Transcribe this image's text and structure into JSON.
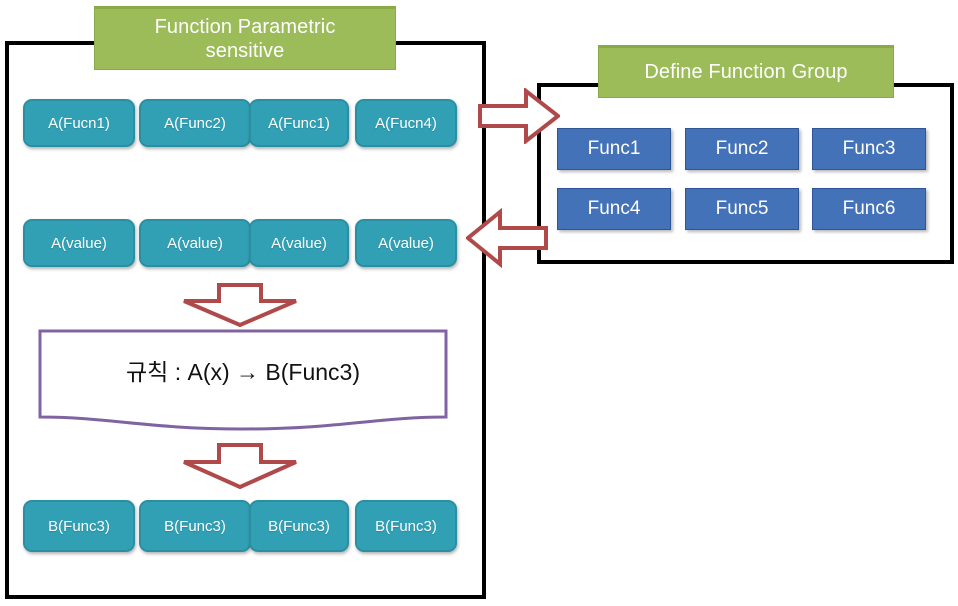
{
  "diagram": {
    "title_left": "Function Parametric\nsensitive",
    "title_right": "Define Function Group"
  },
  "left_panel": {
    "banner_line1": "Function Parametric",
    "banner_line2": "sensitive",
    "func_row": [
      {
        "label": "A(Fucn1)"
      },
      {
        "label": "A(Func2)"
      },
      {
        "label": "A(Func1)"
      },
      {
        "label": "A(Fucn4)"
      }
    ],
    "value_row": [
      {
        "label": "A(value)"
      },
      {
        "label": "A(value)"
      },
      {
        "label": "A(value)"
      },
      {
        "label": "A(value)"
      }
    ],
    "rule": {
      "text": "규칙 : A(x) → B(Func3)"
    },
    "result_row": [
      {
        "label": "B(Func3)"
      },
      {
        "label": "B(Func3)"
      },
      {
        "label": "B(Func3)"
      },
      {
        "label": "B(Func3)"
      }
    ]
  },
  "right_panel": {
    "banner": "Define Function Group",
    "functions": [
      {
        "label": "Func1"
      },
      {
        "label": "Func2"
      },
      {
        "label": "Func3"
      },
      {
        "label": "Func4"
      },
      {
        "label": "Func5"
      },
      {
        "label": "Func6"
      }
    ]
  },
  "arrows": [
    {
      "name": "arrow-right-top",
      "direction": "right"
    },
    {
      "name": "arrow-left-mid",
      "direction": "left"
    },
    {
      "name": "arrow-down-1",
      "direction": "down"
    },
    {
      "name": "arrow-down-2",
      "direction": "down"
    }
  ],
  "colors": {
    "banner_green": "#9CBB59",
    "teal_box": "#31A0B5",
    "blue_box": "#4472B8",
    "arrow_stroke": "#B04A4A",
    "rule_outline": "#8064A2",
    "frame": "#000000",
    "text_light": "#FFFFFF",
    "text_dark": "#111111"
  }
}
